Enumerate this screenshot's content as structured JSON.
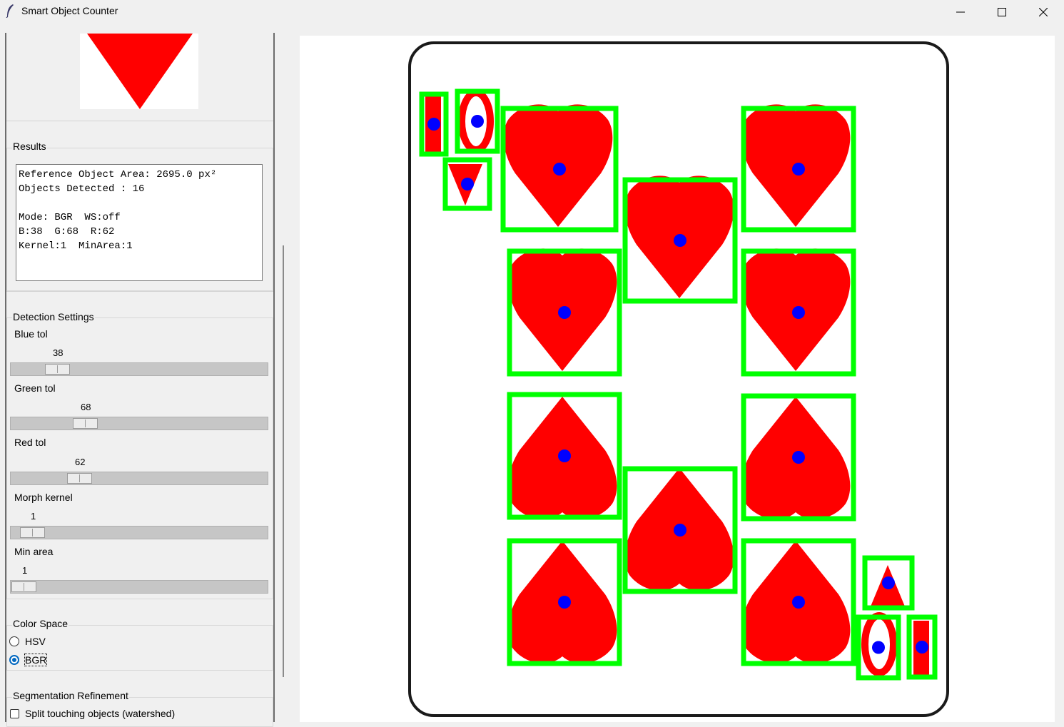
{
  "window": {
    "title": "Smart Object Counter",
    "controls": [
      "minimize-icon",
      "maximize-icon",
      "close-icon"
    ]
  },
  "results": {
    "label": "Results",
    "text": "Reference Object Area: 2695.0 px²\nObjects Detected : 16\n\nMode: BGR  WS:off\nB:38  G:68  R:62\nKernel:1  MinArea:1"
  },
  "detection": {
    "label": "Detection Settings",
    "sliders": [
      {
        "label": "Blue tol",
        "value": "38"
      },
      {
        "label": "Green tol",
        "value": "68"
      },
      {
        "label": "Red tol",
        "value": "62"
      },
      {
        "label": "Morph kernel",
        "value": "1"
      },
      {
        "label": "Min area",
        "value": "1"
      }
    ]
  },
  "color_space": {
    "label": "Color Space",
    "options": [
      "HSV",
      "BGR"
    ],
    "selected": "BGR"
  },
  "segmentation": {
    "label": "Segmentation Refinement",
    "watershed_label": "Split touching objects (watershed)",
    "watershed_checked": false
  },
  "colors": {
    "heart_red": "#ff0000",
    "box_green": "#00ff00",
    "centroid_blue": "#0000ff",
    "accent": "#0067c0"
  },
  "detections_count": 16
}
